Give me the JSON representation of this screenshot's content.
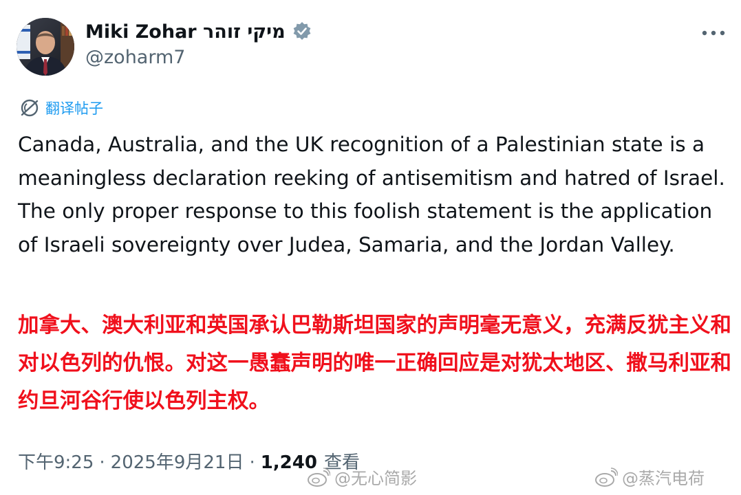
{
  "author": {
    "display_name": "Miki Zohar מיקי זוהר",
    "handle": "@zoharm7",
    "verified": true,
    "avatar_icon": "profile-photo"
  },
  "translate_link": {
    "label": "翻译帖子",
    "icon": "translate-icon",
    "color": "#1d9bf0"
  },
  "tweet": {
    "text": "Canada, Australia, and the UK recognition of a Palestinian state is a meaningless declaration reeking of antisemitism and hatred of Israel. The only proper response to this foolish statement is the application of Israeli sovereignty over Judea, Samaria, and the Jordan Valley.",
    "translation": "加拿大、澳大利亚和英国承认巴勒斯坦国家的声明毫无意义，充满反犹主义和对以色列的仇恨。对这一愚蠢声明的唯一正确回应是对犹太地区、撒马利亚和约旦河谷行使以色列主权。",
    "translation_color": "#f0101c"
  },
  "meta": {
    "time": "下午9:25",
    "separator": "·",
    "date": "2025年9月21日",
    "views_count": "1,240",
    "views_label": "查看"
  },
  "watermarks": {
    "left": "@无心简影",
    "right": "@蒸汽电荷",
    "icon": "weibo-icon"
  },
  "colors": {
    "text_primary": "#0f1419",
    "text_secondary": "#536471",
    "verified_badge": "#829aab"
  }
}
